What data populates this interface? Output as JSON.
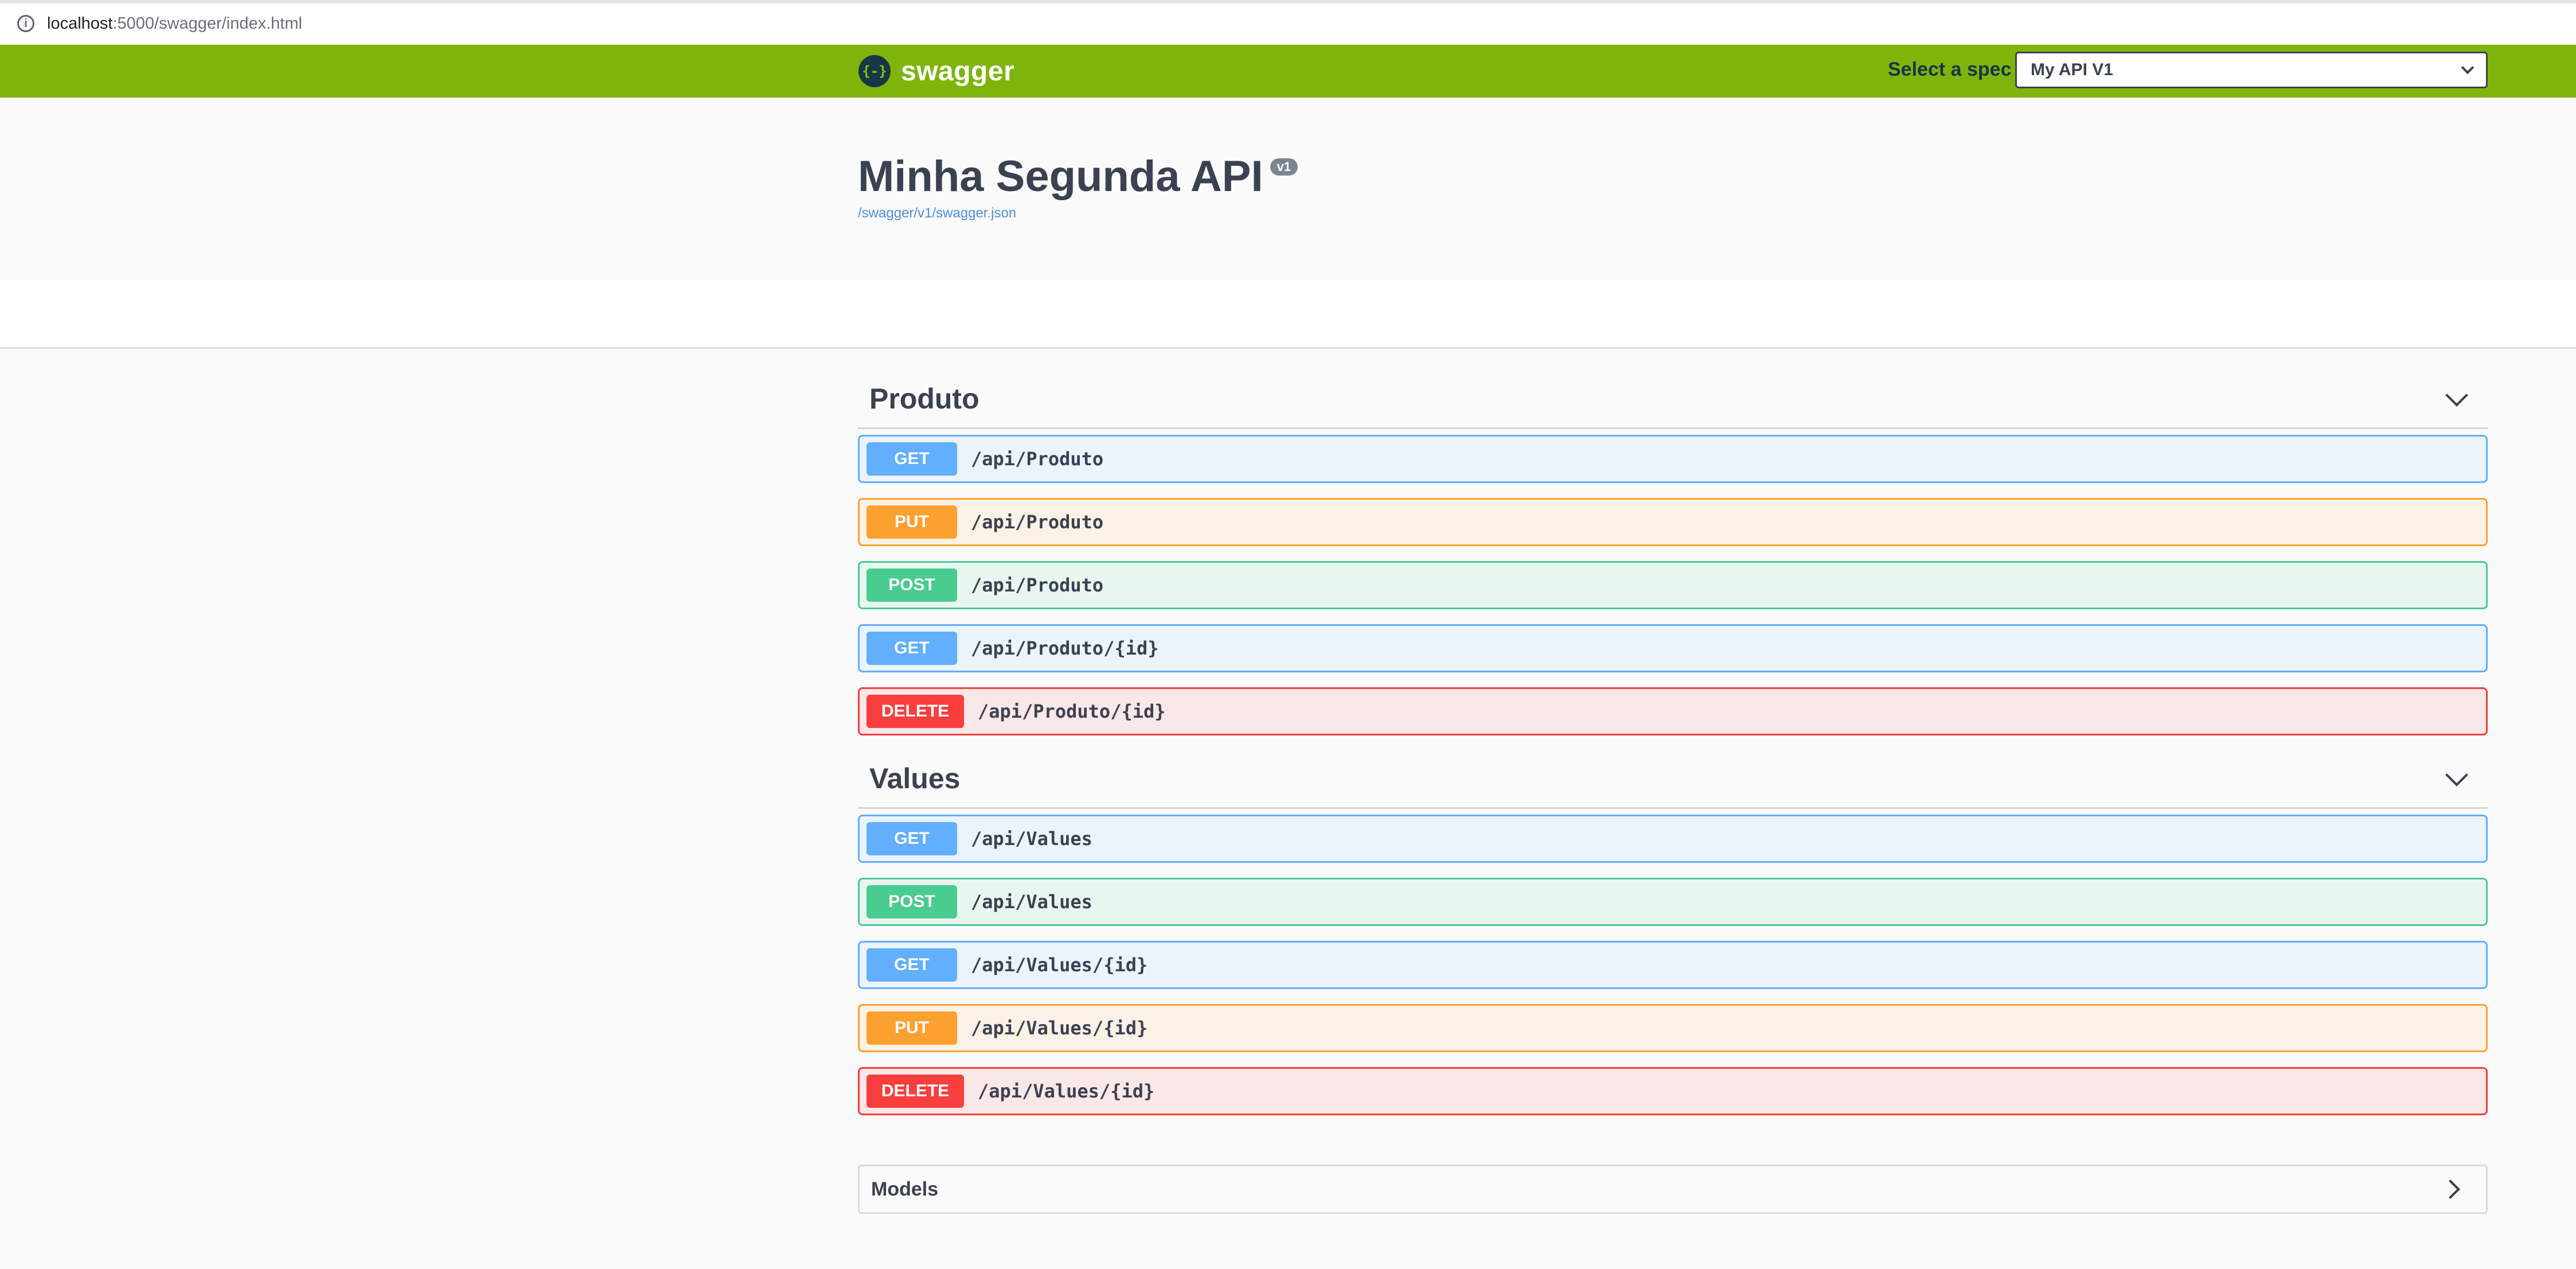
{
  "browser": {
    "url_host": "localhost",
    "url_path": ":5000/swagger/index.html"
  },
  "topbar": {
    "logo_glyph": "{-}",
    "logo_text": "swagger",
    "spec_label": "Select a spec",
    "spec_selected": "My API V1",
    "bg_color": "#7fb50b"
  },
  "info": {
    "title": "Minha Segunda API",
    "version": "v1",
    "spec_link": "/swagger/v1/swagger.json"
  },
  "tags": [
    {
      "name": "Produto",
      "operations": [
        {
          "method": "GET",
          "path": "/api/Produto"
        },
        {
          "method": "PUT",
          "path": "/api/Produto"
        },
        {
          "method": "POST",
          "path": "/api/Produto"
        },
        {
          "method": "GET",
          "path": "/api/Produto/{id}"
        },
        {
          "method": "DELETE",
          "path": "/api/Produto/{id}"
        }
      ]
    },
    {
      "name": "Values",
      "operations": [
        {
          "method": "GET",
          "path": "/api/Values"
        },
        {
          "method": "POST",
          "path": "/api/Values"
        },
        {
          "method": "GET",
          "path": "/api/Values/{id}"
        },
        {
          "method": "PUT",
          "path": "/api/Values/{id}"
        },
        {
          "method": "DELETE",
          "path": "/api/Values/{id}"
        }
      ]
    }
  ],
  "models": {
    "title": "Models"
  },
  "method_colors": {
    "GET": "#61affe",
    "PUT": "#fca130",
    "POST": "#49cc90",
    "DELETE": "#f93e3e"
  }
}
